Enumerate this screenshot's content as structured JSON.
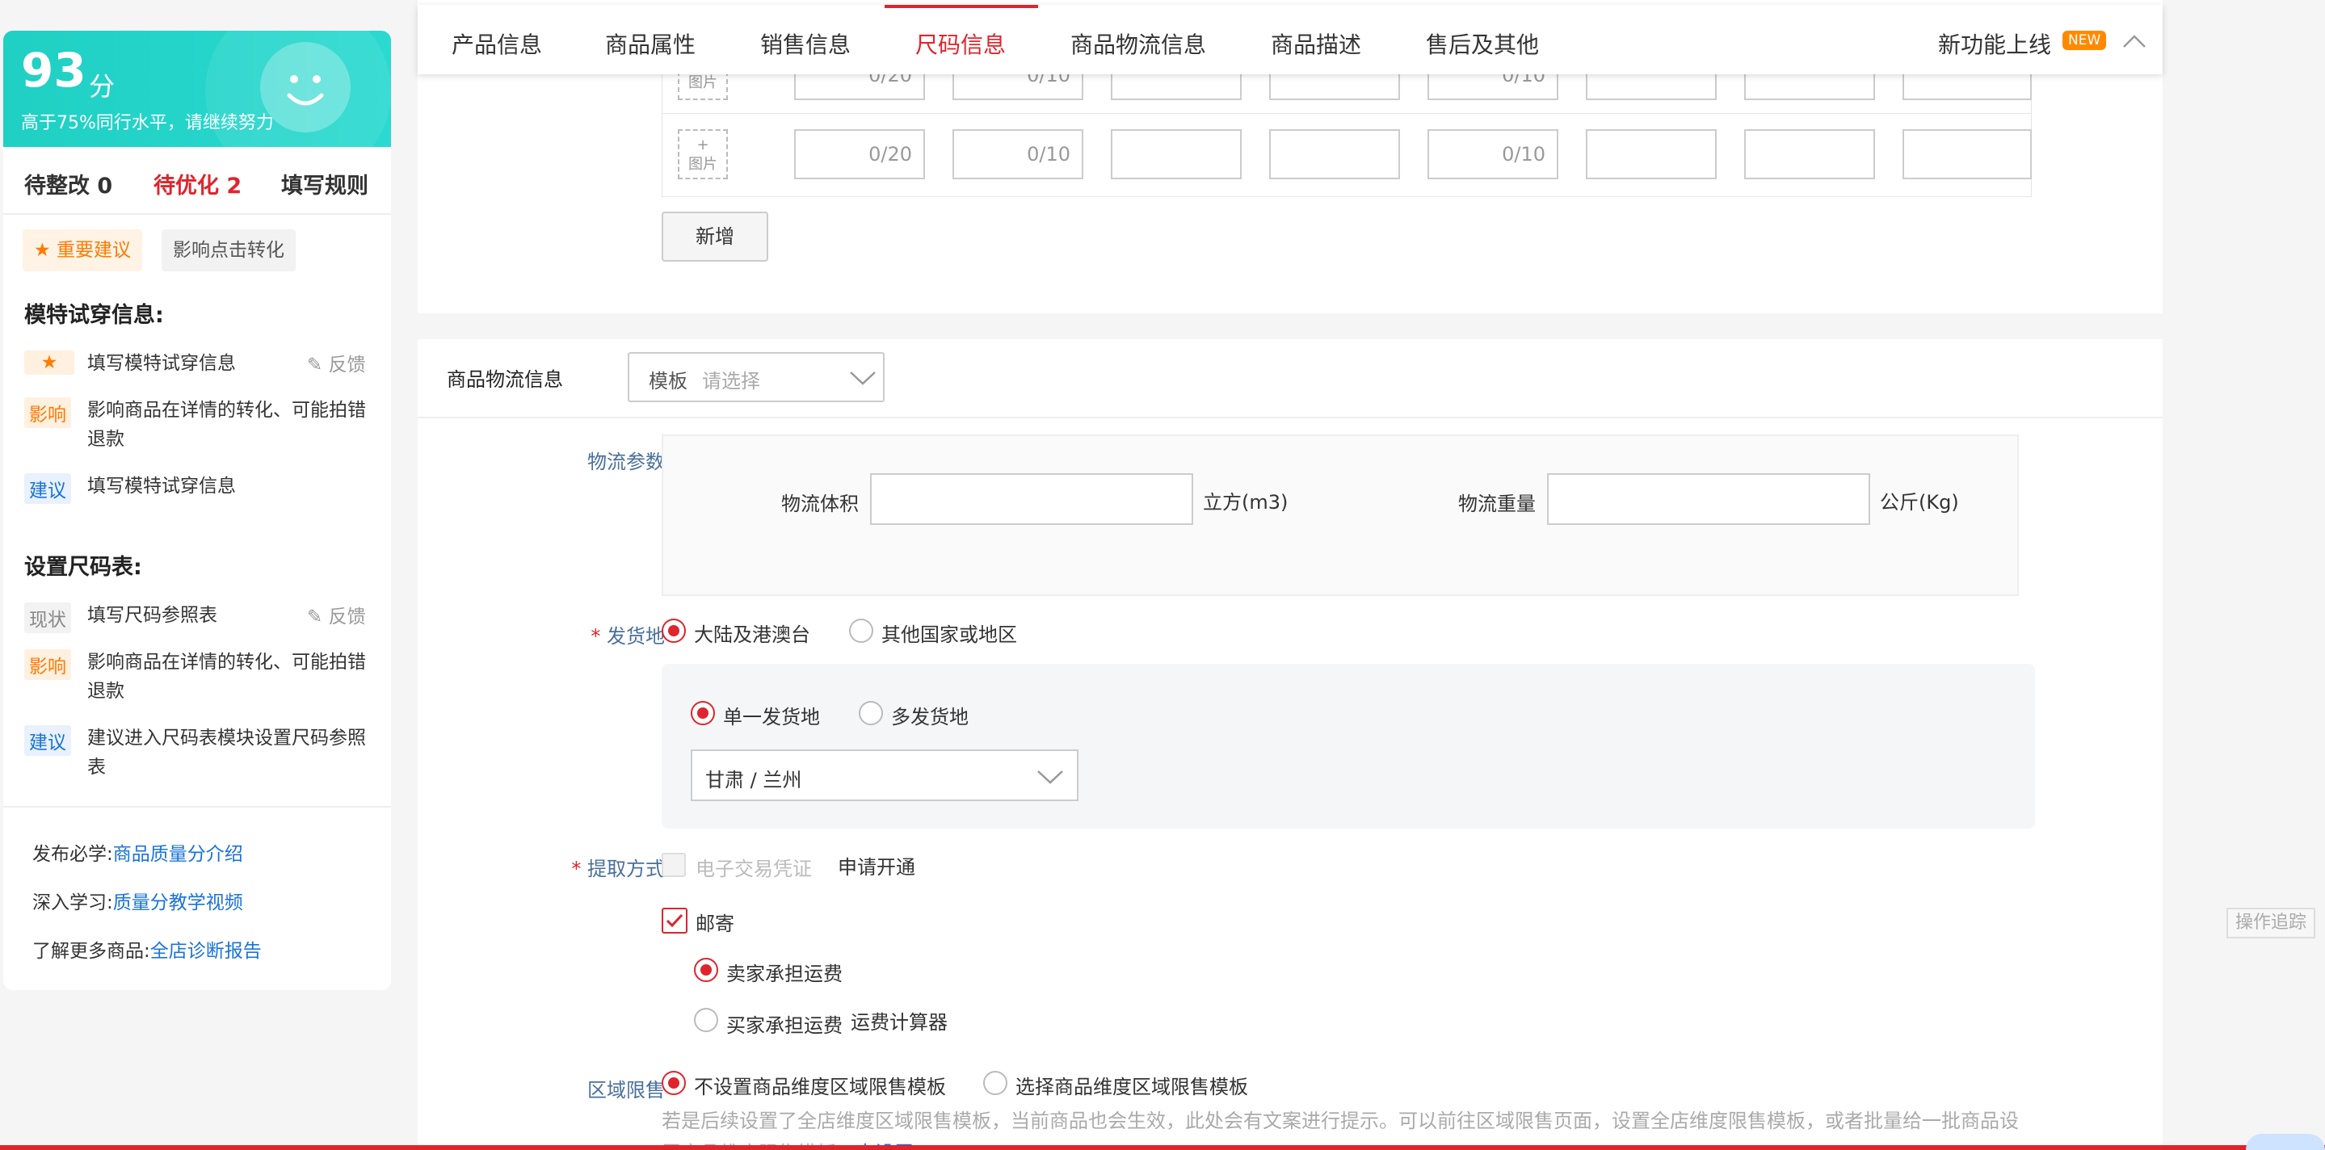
{
  "score": {
    "value": "93",
    "unit": "分",
    "subtitle": "高于75%同行水平，请继续努力"
  },
  "left_tabs": {
    "pending_fix": "待整改 0",
    "pending_opt": "待优化 2",
    "rules": "填写规则"
  },
  "filter_tags": {
    "important": "重要建议",
    "conversion": "影响点击转化"
  },
  "section1": {
    "title": "模特试穿信息:",
    "status_label": "",
    "status_text": "填写模特试穿信息",
    "feedback": "反馈",
    "impact_label": "影响",
    "impact_text": "影响商品在详情的转化、可能拍错退款",
    "suggest_label": "建议",
    "suggest_text": "填写模特试穿信息"
  },
  "section2": {
    "title": "设置尺码表:",
    "status_label": "现状",
    "status_text": "填写尺码参照表",
    "feedback": "反馈",
    "impact_label": "影响",
    "impact_text": "影响商品在详情的转化、可能拍错退款",
    "suggest_label": "建议",
    "suggest_text": "建议进入尺码表模块设置尺码参照表"
  },
  "footer_links": [
    {
      "prefix": "发布必学:",
      "link": "商品质量分介绍"
    },
    {
      "prefix": "深入学习:",
      "link": "质量分教学视频"
    },
    {
      "prefix": "了解更多商品:",
      "link": "全店诊断报告"
    }
  ],
  "nav": {
    "tabs": [
      "产品信息",
      "商品属性",
      "销售信息",
      "尺码信息",
      "商品物流信息",
      "商品描述",
      "售后及其他"
    ],
    "active": "尺码信息",
    "new_feature": "新功能上线",
    "new_badge": "NEW"
  },
  "size_table": {
    "pic_label": "图片",
    "counters": [
      "0/20",
      "0/10",
      "0/10"
    ],
    "add_button": "新增"
  },
  "logistics": {
    "title": "商品物流信息",
    "template_label": "模板",
    "template_placeholder": "请选择",
    "params_label": "物流参数",
    "volume_label": "物流体积",
    "volume_unit": "立方(m3)",
    "weight_label": "物流重量",
    "weight_unit": "公斤(Kg)"
  },
  "ship_from": {
    "label": "发货地",
    "opt_mainland": "大陆及港澳台",
    "opt_other": "其他国家或地区",
    "opt_single": "单一发货地",
    "opt_multi": "多发货地",
    "location": "甘肃 / 兰州"
  },
  "pickup": {
    "label": "提取方式",
    "evoucher": "电子交易凭证",
    "apply": "申请开通",
    "mail": "邮寄",
    "seller_pays": "卖家承担运费",
    "buyer_pays": "买家承担运费",
    "calc": "运费计算器"
  },
  "region": {
    "label": "区域限售",
    "opt_none": "不设置商品维度区域限售模板",
    "opt_select": "选择商品维度区域限售模板",
    "note": "若是后续设置了全店维度区域限售模板，当前商品也会生效，此处会有文案进行提示。可以前往区域限售页面，设置全店维度限售模板，或者批量给一批商品设置商品维度限售模板。",
    "note_link": "去设置"
  },
  "side_button": "操作追踪"
}
